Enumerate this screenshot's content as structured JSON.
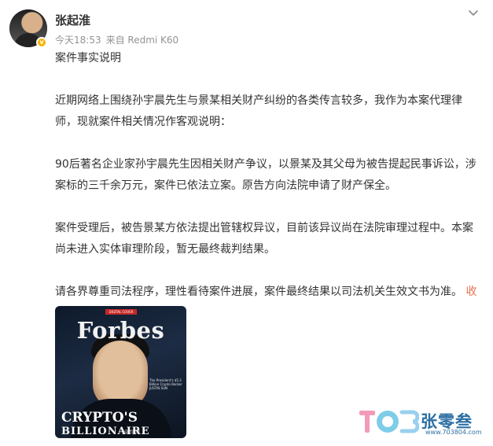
{
  "author": {
    "name": "张起淮",
    "verified_badge": "v"
  },
  "post_meta": {
    "time": "今天18:53",
    "source": "来自 Redmi K60"
  },
  "post": {
    "paragraphs": [
      "案件事实说明",
      "近期网络上围绕孙宇晨先生与景某相关财产纠纷的各类传言较多，我作为本案代理律师，现就案件相关情况作客观说明：",
      "90后著名企业家孙宇晨先生因相关财产争议，以景某及其父母为被告提起民事诉讼，涉案标的三千余万元，案件已依法立案。原告方向法院申请了财产保全。",
      "案件受理后，被告景某方依法提出管辖权异议，目前该异议尚在法院审理过程中。本案尚未进入实体审理阶段，暂无最终裁判结果。",
      "请各界尊重司法程序，理性看待案件进展，案件最终结果以司法机关生效文书为准。"
    ],
    "collapse_label": "收起",
    "collapse_icon": "chevron-up-icon",
    "collapse_color": "#eb7350"
  },
  "image": {
    "ribbon": "DIGITAL COVER",
    "masthead": "Forbes",
    "tagline": "The President's $5.3 Billion Crypto Backer JUSTIN SUN",
    "headline_1": "CRYPTO'S",
    "headline_2": "BILLIONAIRE BADLEY",
    "credit": "@张起淮"
  },
  "watermark": {
    "brand": "张零叁",
    "url": "www.703804.com"
  },
  "menu_icon": "chevron-down-icon"
}
